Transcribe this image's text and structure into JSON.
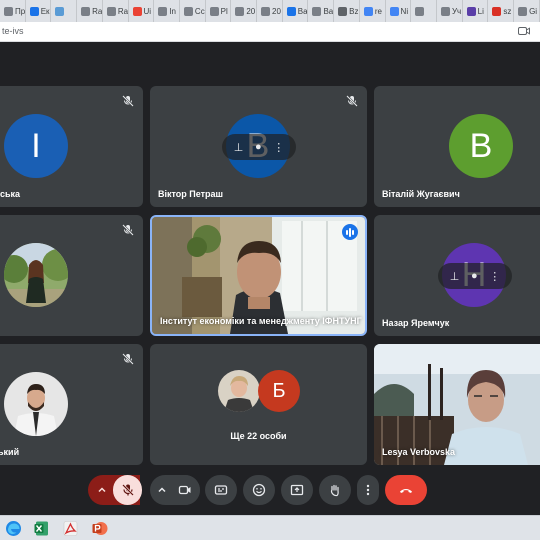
{
  "browser": {
    "tabs": [
      {
        "label": "Пр",
        "color": "#7a7f87"
      },
      {
        "label": "Ек",
        "color": "#1a73e8"
      },
      {
        "label": "",
        "color": "#5a9bd5"
      },
      {
        "label": "Ra",
        "color": "#7a7f87"
      },
      {
        "label": "Ra",
        "color": "#7a7f87"
      },
      {
        "label": "Ui",
        "color": "#ea4335"
      },
      {
        "label": "In",
        "color": "#7a7f87"
      },
      {
        "label": "Cc",
        "color": "#7a7f87"
      },
      {
        "label": "Pl",
        "color": "#7a7f87"
      },
      {
        "label": "20",
        "color": "#7a7f87"
      },
      {
        "label": "20",
        "color": "#7a7f87"
      },
      {
        "label": "Ba",
        "color": "#1a73e8"
      },
      {
        "label": "Ba",
        "color": "#7a7f87"
      },
      {
        "label": "Bz",
        "color": "#5f6368"
      },
      {
        "label": "re",
        "color": "#4285f4"
      },
      {
        "label": "Ni",
        "color": "#4285f4"
      },
      {
        "label": "",
        "color": "#7a7f87"
      },
      {
        "label": "Уч",
        "color": "#7a7f87"
      },
      {
        "label": "Li",
        "color": "#5a3ea8"
      },
      {
        "label": "sz",
        "color": "#d93025"
      },
      {
        "label": "Gi",
        "color": "#7a7f87"
      }
    ],
    "url": "te-ivs"
  },
  "participants": [
    {
      "name": "ська",
      "initial": "I",
      "color": "#1a5fb4"
    },
    {
      "name": "Віктор Петраш",
      "initial": "B",
      "color": "#0b57a8"
    },
    {
      "name": "Віталій Жугаєвич",
      "initial": "B",
      "color": "#5d9e2f"
    },
    {
      "name": "",
      "initial": "",
      "color": "#5b7f3a"
    },
    {
      "name": "Інститут економіки та менеджменту ІФНТУНГ",
      "initial": "",
      "color": ""
    },
    {
      "name": "Назар Яремчук",
      "initial": "H",
      "color": "#5e35b1"
    },
    {
      "name": "ький",
      "initial": "",
      "color": "#e8e8e8"
    },
    {
      "name": "Ще 22 особи",
      "initial": "Б",
      "color": "#c5391f"
    },
    {
      "name": "Lesya Verbovska",
      "initial": "",
      "color": ""
    }
  ],
  "overlay_icons": {
    "pin": "pin-icon",
    "mute": "mic-off-icon",
    "more": "more-vert-icon"
  },
  "controls": [
    "chevron-up-icon",
    "mic-off-icon",
    "chevron-up-icon",
    "camera-icon",
    "captions-icon",
    "emoji-icon",
    "present-icon",
    "raise-hand-icon",
    "more-vert-icon",
    "end-call-icon"
  ],
  "taskbar": [
    "edge-icon",
    "excel-icon",
    "acrobat-icon",
    "powerpoint-icon"
  ],
  "colors": {
    "accent": "#8ab4f8",
    "tile": "#3c4043",
    "end_call": "#ea4335",
    "mic_off": "#f9dedc"
  }
}
